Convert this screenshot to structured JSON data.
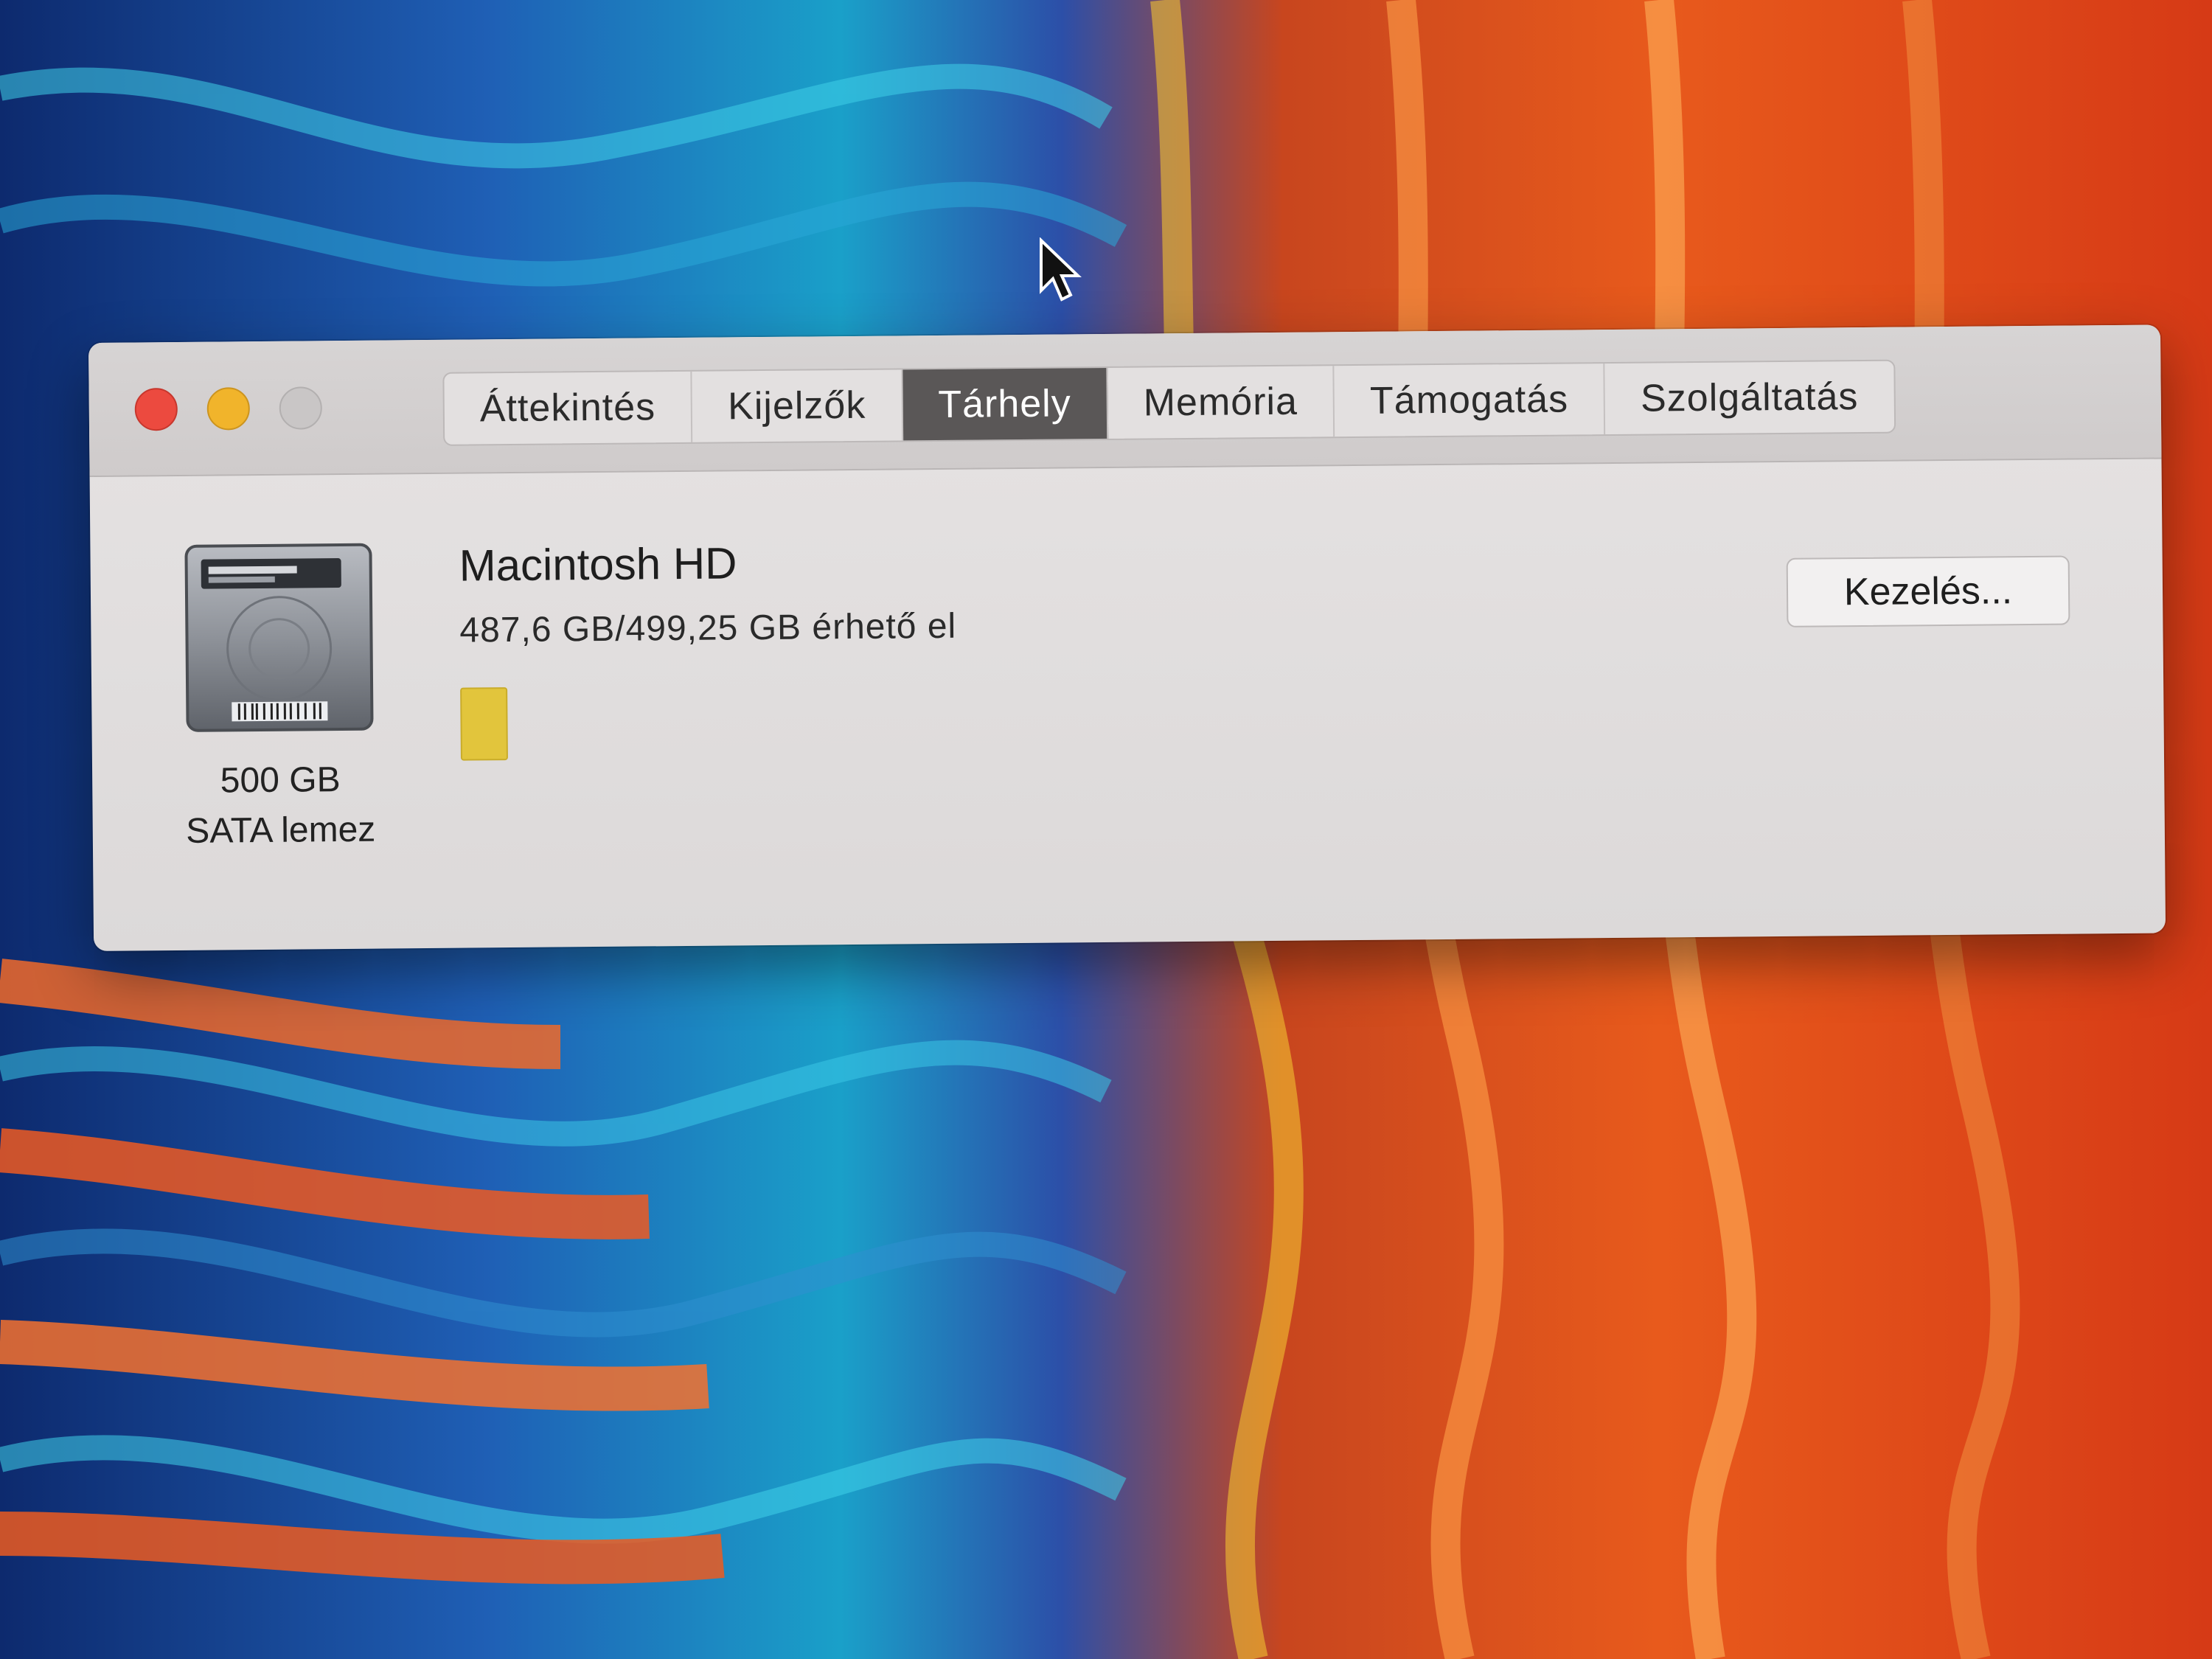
{
  "window": {
    "tabs": [
      {
        "label": "Áttekintés",
        "active": false
      },
      {
        "label": "Kijelzők",
        "active": false
      },
      {
        "label": "Tárhely",
        "active": true
      },
      {
        "label": "Memória",
        "active": false
      },
      {
        "label": "Támogatás",
        "active": false
      },
      {
        "label": "Szolgáltatás",
        "active": false
      }
    ]
  },
  "disk": {
    "icon": "hard-drive-icon",
    "capacity": "500 GB",
    "type": "SATA lemez"
  },
  "volume": {
    "name": "Macintosh HD",
    "available_text": "487,6 GB/499,25 GB érhető el",
    "used_fraction": 0.023,
    "used_color": "#e2c53c"
  },
  "actions": {
    "manage_label": "Kezelés..."
  },
  "colors": {
    "close": "#ec4a3f",
    "minimize": "#f1b42b",
    "zoom": "#c9c6c6",
    "active_tab": "#5a5757"
  }
}
